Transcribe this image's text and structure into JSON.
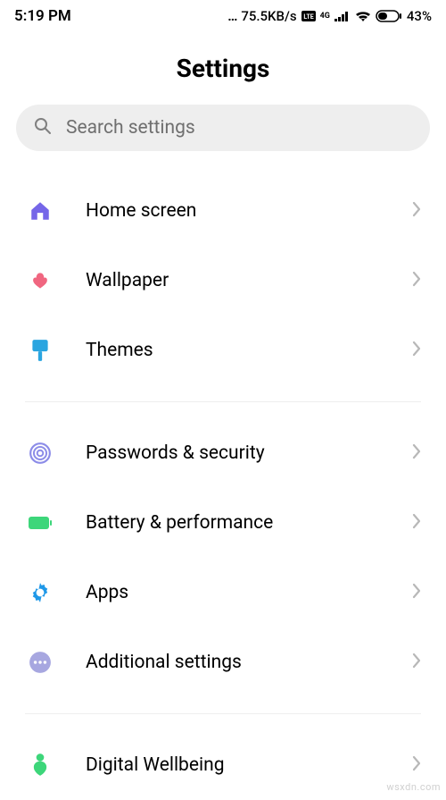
{
  "status": {
    "time": "5:19 PM",
    "network_speed": "75.5KB/s",
    "battery_percent": "43%"
  },
  "title": "Settings",
  "search": {
    "placeholder": "Search settings"
  },
  "groups": [
    {
      "items": [
        {
          "id": "home-screen",
          "label": "Home screen",
          "icon": "home",
          "color": "#7566e8"
        },
        {
          "id": "wallpaper",
          "label": "Wallpaper",
          "icon": "flower",
          "color": "#f06680"
        },
        {
          "id": "themes",
          "label": "Themes",
          "icon": "brush",
          "color": "#2aa5e0"
        }
      ]
    },
    {
      "items": [
        {
          "id": "passwords-security",
          "label": "Passwords & security",
          "icon": "fingerprint",
          "color": "#8c8ce8"
        },
        {
          "id": "battery-performance",
          "label": "Battery & performance",
          "icon": "battery",
          "color": "#3dd67a"
        },
        {
          "id": "apps",
          "label": "Apps",
          "icon": "gear",
          "color": "#1f98e8"
        },
        {
          "id": "additional-settings",
          "label": "Additional settings",
          "icon": "dots",
          "color": "#a7a7e0"
        }
      ]
    },
    {
      "items": [
        {
          "id": "digital-wellbeing",
          "label": "Digital Wellbeing",
          "icon": "wellbeing",
          "color": "#3dd67a"
        }
      ]
    }
  ],
  "watermark": "wsxdn.com"
}
